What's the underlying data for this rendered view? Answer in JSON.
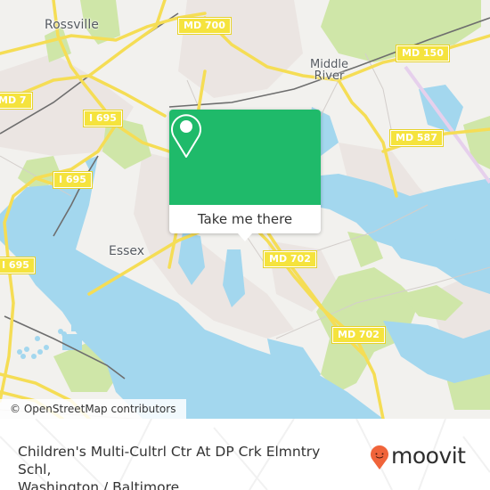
{
  "map": {
    "places": [
      {
        "name": "Rossville"
      },
      {
        "name": "Middle\nRiver"
      },
      {
        "name": "Essex"
      }
    ],
    "shields": [
      "MD 700",
      "MD 150",
      "MD 7",
      "I 695",
      "MD 587",
      "I 695",
      "I 695",
      "MD 702",
      "MD 702"
    ],
    "attribution": "© OpenStreetMap contributors",
    "colors": {
      "water": "#a3d7ee",
      "park": "#cfe6a8",
      "land": "#f2f1ee",
      "urban": "#ece6e3",
      "road": "#f7e463",
      "rail": "#6e6e6e"
    }
  },
  "popup": {
    "icon": "map-pin-icon",
    "button_label": "Take me there",
    "accent": "#1fba6a"
  },
  "footer": {
    "place_line1": "Children's Multi-Cultrl Ctr At DP Crk Elmntry Schl,",
    "place_line2": "Washington / Baltimore",
    "brand": "moovit",
    "brand_color": "#f0643a"
  }
}
